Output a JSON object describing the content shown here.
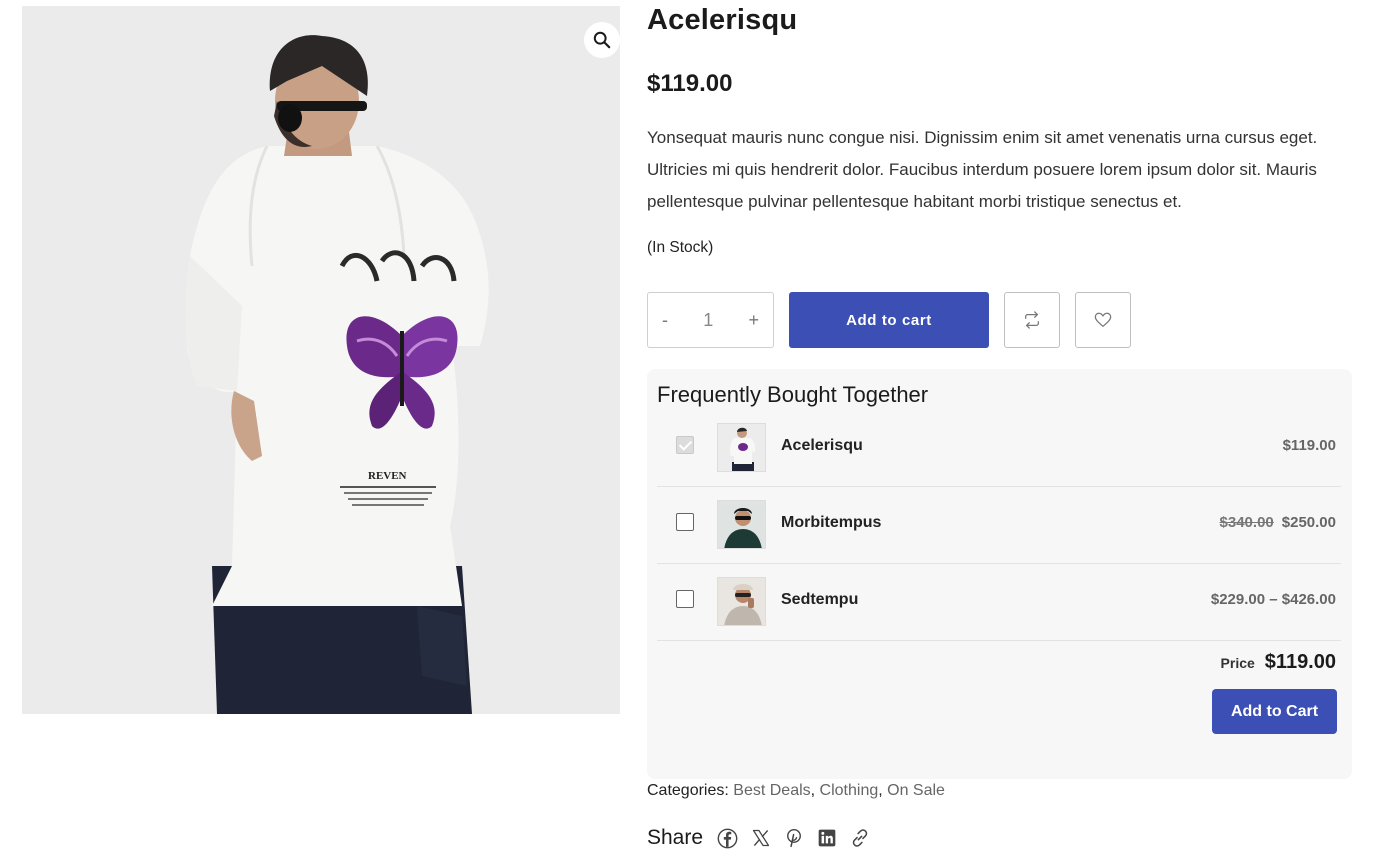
{
  "product": {
    "title": "Acelerisqu",
    "price": "$119.00",
    "description": "Yonsequat mauris nunc congue nisi. Dignissim enim sit amet venenatis urna cursus eget. Ultricies mi quis hendrerit dolor. Faucibus interdum posuere lorem ipsum dolor sit. Mauris pellentesque pulvinar pellentesque habitant morbi tristique senectus et.",
    "stock": "(In Stock)"
  },
  "cart": {
    "minus": "-",
    "quantity": "1",
    "plus": "+",
    "add_label": "Add to cart"
  },
  "image": {
    "print_text": "REVEN"
  },
  "fbt": {
    "title": "Frequently Bought Together",
    "items": [
      {
        "name": "Acelerisqu",
        "price": "$119.00",
        "old_price": "",
        "checked": true
      },
      {
        "name": "Morbitempus",
        "price": "$250.00",
        "old_price": "$340.00",
        "checked": false
      },
      {
        "name": "Sedtempu",
        "price": "$229.00 – $426.00",
        "old_price": "",
        "checked": false
      }
    ],
    "total_label": "Price",
    "total_value": "$119.00",
    "button_label": "Add to Cart"
  },
  "meta": {
    "categories_label": "Categories:",
    "categories": [
      "Best Deals",
      "Clothing",
      "On Sale"
    ],
    "share_label": "Share"
  },
  "colors": {
    "accent": "#3b4fb5",
    "panel": "#f7f7f7"
  },
  "icons": [
    "search-icon",
    "compare-icon",
    "heart-icon",
    "facebook-icon",
    "x-icon",
    "pinterest-icon",
    "linkedin-icon",
    "link-icon"
  ]
}
